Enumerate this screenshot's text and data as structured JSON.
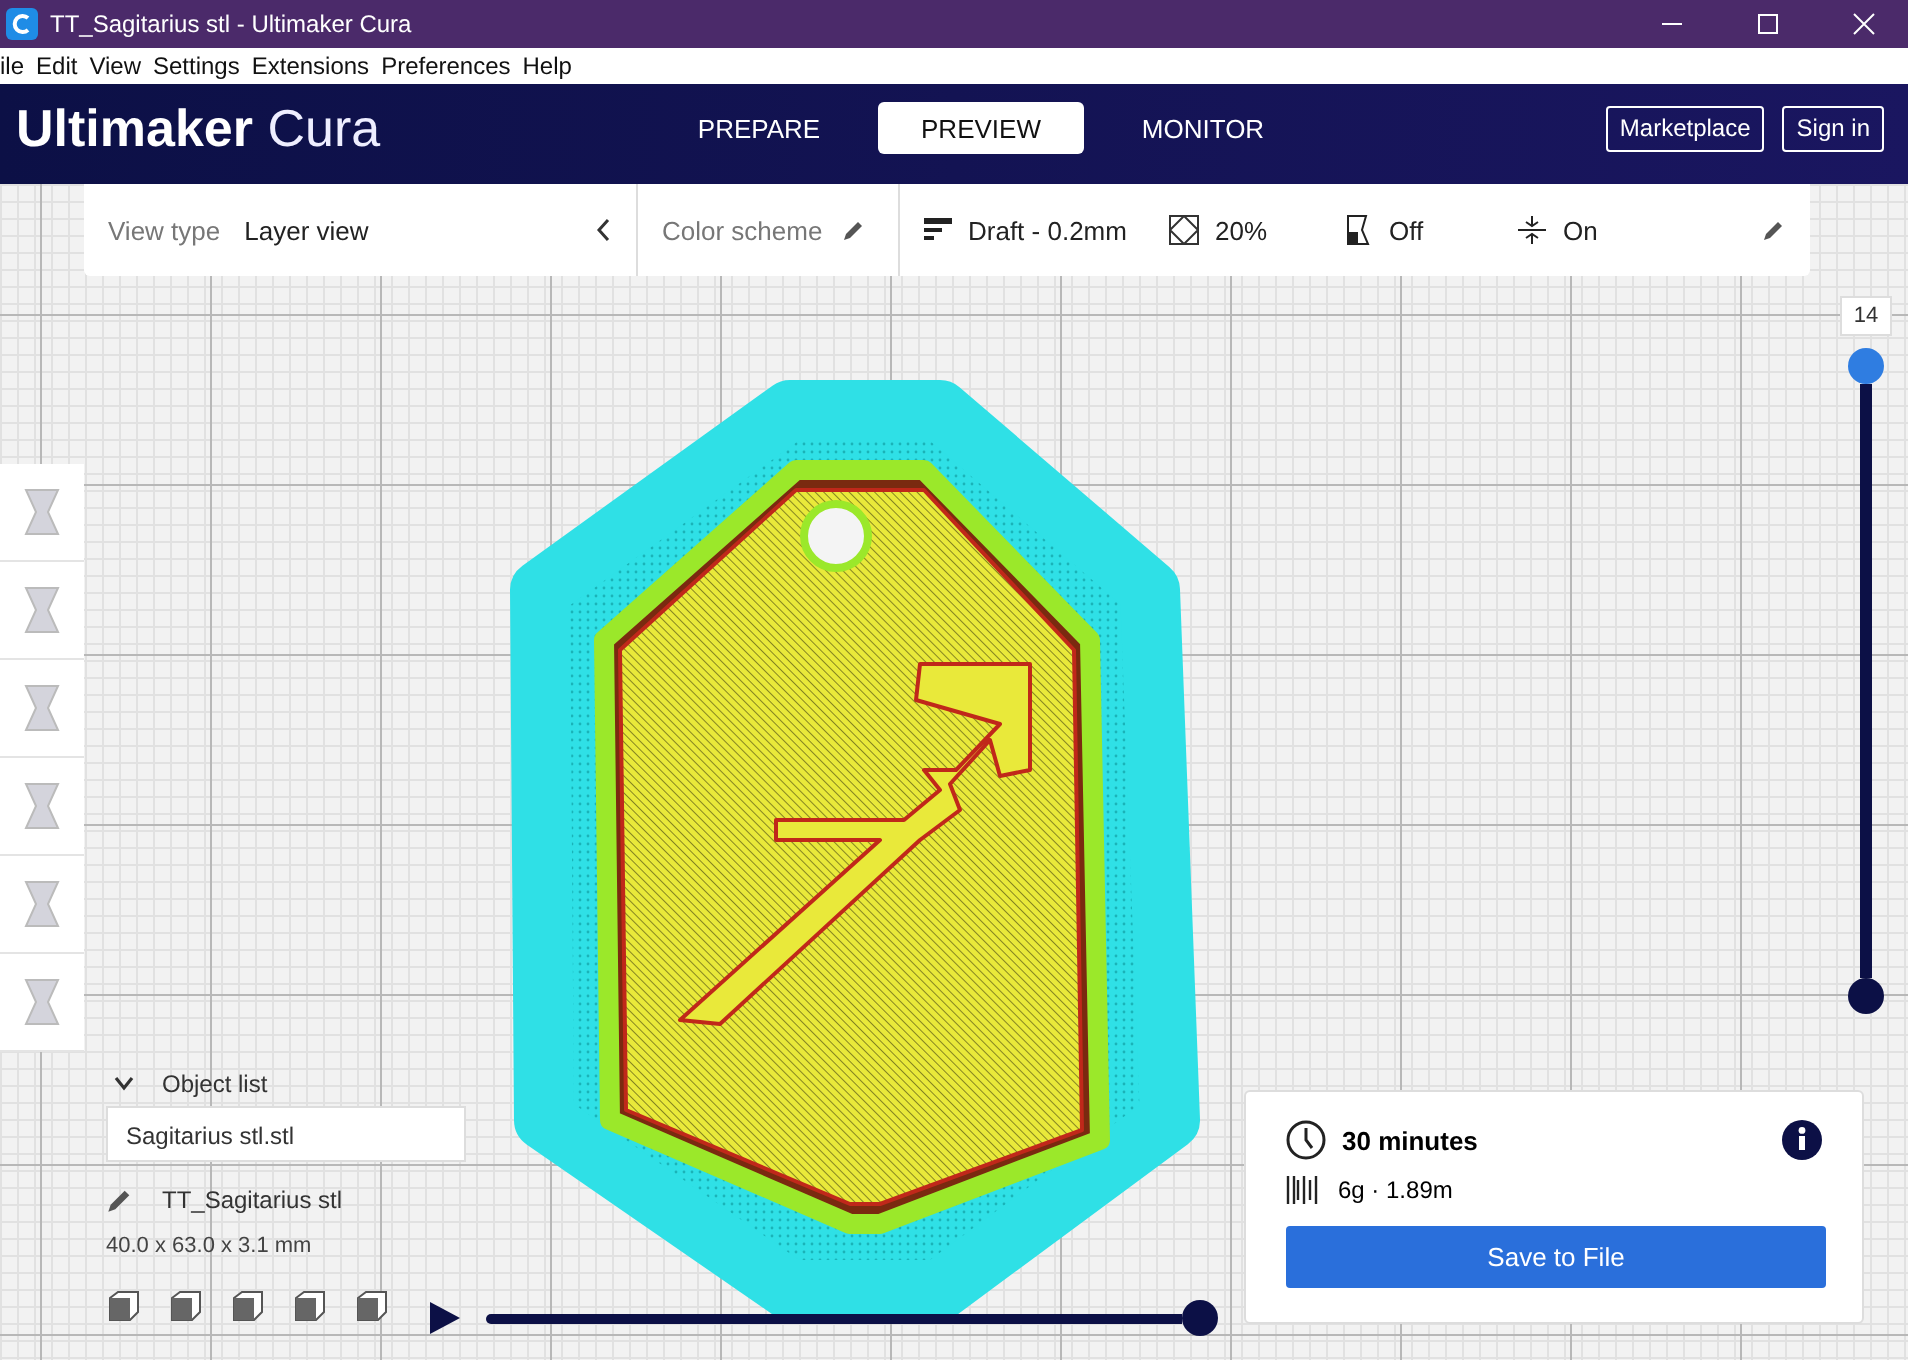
{
  "window": {
    "title": "TT_Sagitarius stl - Ultimaker Cura"
  },
  "menu": [
    "ile",
    "Edit",
    "View",
    "Settings",
    "Extensions",
    "Preferences",
    "Help"
  ],
  "header": {
    "brand": "Ultimaker",
    "product": "Cura",
    "stages": [
      {
        "label": "PREPARE",
        "selected": false
      },
      {
        "label": "PREVIEW",
        "selected": true
      },
      {
        "label": "MONITOR",
        "selected": false
      }
    ],
    "buttons": [
      "Marketplace",
      "Sign in"
    ]
  },
  "toolbar": {
    "view_type_label": "View type",
    "view_type_value": "Layer view",
    "color_scheme_label": "Color scheme",
    "profile": "Draft - 0.2mm",
    "infill": "20%",
    "support": "Off",
    "adhesion": "On"
  },
  "object_list": {
    "title": "Object list",
    "expanded": true,
    "items": [
      "Sagitarius stl.stl"
    ],
    "selected_name": "TT_Sagitarius stl",
    "dimensions": "40.0 x 63.0 x 3.1 mm"
  },
  "layer_slider": {
    "label": "14",
    "level": 1
  },
  "path_slider": {
    "level": 1
  },
  "print_info": {
    "time": "30 minutes",
    "material": "6g · 1.89m",
    "button": "Save to File"
  }
}
